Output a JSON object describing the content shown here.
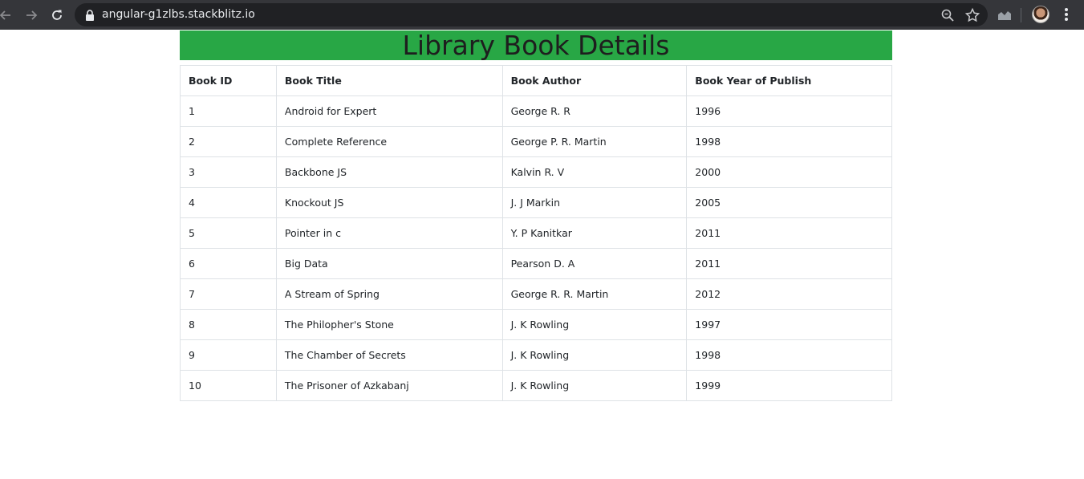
{
  "browser": {
    "url": "angular-g1zlbs.stackblitz.io",
    "icons": {
      "back": "arrow-left-icon",
      "forward": "arrow-right-icon",
      "reload": "reload-icon",
      "lock": "lock-icon",
      "zoom": "magnifier-icon",
      "bookmark": "star-icon",
      "extension": "chart-extension-icon",
      "profile": "avatar",
      "menu": "kebab-menu-icon"
    }
  },
  "page": {
    "title": "Library Book Details",
    "banner_color": "#28a745",
    "table": {
      "headers": [
        "Book ID",
        "Book Title",
        "Book Author",
        "Book Year of Publish"
      ],
      "rows": [
        [
          "1",
          "Android for Expert",
          "George R. R",
          "1996"
        ],
        [
          "2",
          "Complete Reference",
          "George P. R. Martin",
          "1998"
        ],
        [
          "3",
          "Backbone JS",
          "Kalvin R. V",
          "2000"
        ],
        [
          "4",
          "Knockout JS",
          "J. J Markin",
          "2005"
        ],
        [
          "5",
          "Pointer in c",
          "Y. P Kanitkar",
          "2011"
        ],
        [
          "6",
          "Big Data",
          "Pearson D. A",
          "2011"
        ],
        [
          "7",
          "A Stream of Spring",
          "George R. R. Martin",
          "2012"
        ],
        [
          "8",
          "The Philopher's Stone",
          "J. K Rowling",
          "1997"
        ],
        [
          "9",
          "The Chamber of Secrets",
          "J. K Rowling",
          "1998"
        ],
        [
          "10",
          "The Prisoner of Azkabanj",
          "J. K Rowling",
          "1999"
        ]
      ]
    }
  }
}
